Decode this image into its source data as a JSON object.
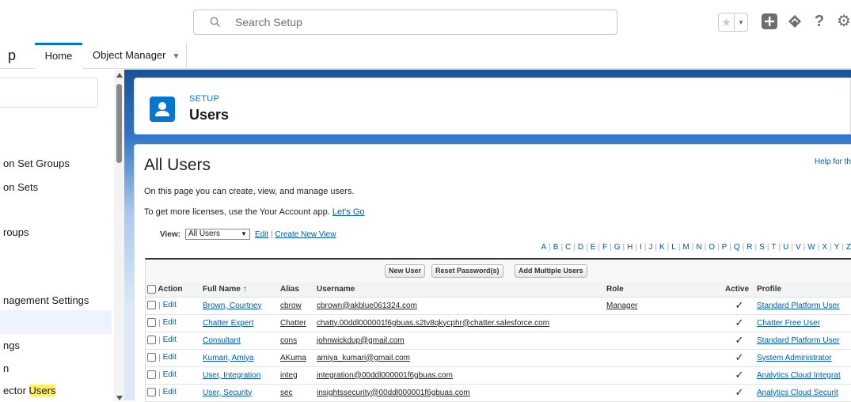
{
  "header": {
    "search_placeholder": "Search Setup",
    "icons": [
      "star-icon",
      "chevron-down-icon",
      "add-icon",
      "trailhead-icon",
      "help-icon",
      "gear-icon"
    ]
  },
  "nav": {
    "app_name_fragment": "p",
    "tabs": [
      {
        "label": "Home",
        "active": true
      },
      {
        "label": "Object Manager",
        "active": false
      }
    ]
  },
  "sidebar": {
    "items": [
      {
        "label": "on Set Groups"
      },
      {
        "label": "on Sets"
      },
      {
        "label": "roups"
      },
      {
        "label": "nagement Settings"
      },
      {
        "label": "ngs"
      },
      {
        "label": "n"
      },
      {
        "label_prefix": "ector ",
        "label_highlight": "Users"
      }
    ]
  },
  "page_header": {
    "eyebrow": "SETUP",
    "title": "Users"
  },
  "content": {
    "title": "All Users",
    "help_link": "Help for th",
    "description": "On this page you can create, view, and manage users.",
    "licenses_text": "To get more licenses, use the Your Account app.",
    "lets_go": "Let's Go",
    "view_label": "View:",
    "view_value": "All Users",
    "edit_link": "Edit",
    "create_view_link": "Create New View",
    "alphabet": [
      "A",
      "B",
      "C",
      "D",
      "E",
      "F",
      "G",
      "H",
      "I",
      "J",
      "K",
      "L",
      "M",
      "N",
      "O",
      "P",
      "Q",
      "R",
      "S",
      "T",
      "U",
      "V",
      "W",
      "X",
      "Y",
      "Z"
    ]
  },
  "table": {
    "buttons": [
      "New User",
      "Reset Password(s)",
      "Add Multiple Users"
    ],
    "columns": [
      "Action",
      "Full Name ↑",
      "Alias",
      "Username",
      "Role",
      "Active",
      "Profile"
    ],
    "edit_label": "Edit",
    "rows": [
      {
        "name": "Brown, Courtney",
        "alias": "cbrow",
        "username": "cbrown@akblue061324.com",
        "role": "Manager",
        "active": "✓",
        "profile": "Standard Platform User"
      },
      {
        "name": "Chatter Expert",
        "alias": "Chatter",
        "username": "chatty.00ddl000001f6gbuas.s2tv8qkycphr@chatter.salesforce.com",
        "role": "",
        "active": "✓",
        "profile": "Chatter Free User"
      },
      {
        "name": "Consultant",
        "alias": "cons",
        "username": "johnwickdup@gmail.com",
        "role": "",
        "active": "✓",
        "profile": "Standard Platform User"
      },
      {
        "name": "Kumari, Amiya",
        "alias": "AKuma",
        "username": "amiya_kumari@gmail.com",
        "role": "",
        "active": "✓",
        "profile": "System Administrator"
      },
      {
        "name": "User, Integration",
        "alias": "integ",
        "username": "integration@00ddl000001f6gbuas.com",
        "role": "",
        "active": "✓",
        "profile": "Analytics Cloud Integrat"
      },
      {
        "name": "User, Security",
        "alias": "sec",
        "username": "insightssecurity@00ddl000001f6gbuas.com",
        "role": "",
        "active": "✓",
        "profile": "Analytics Cloud Securit"
      }
    ]
  }
}
